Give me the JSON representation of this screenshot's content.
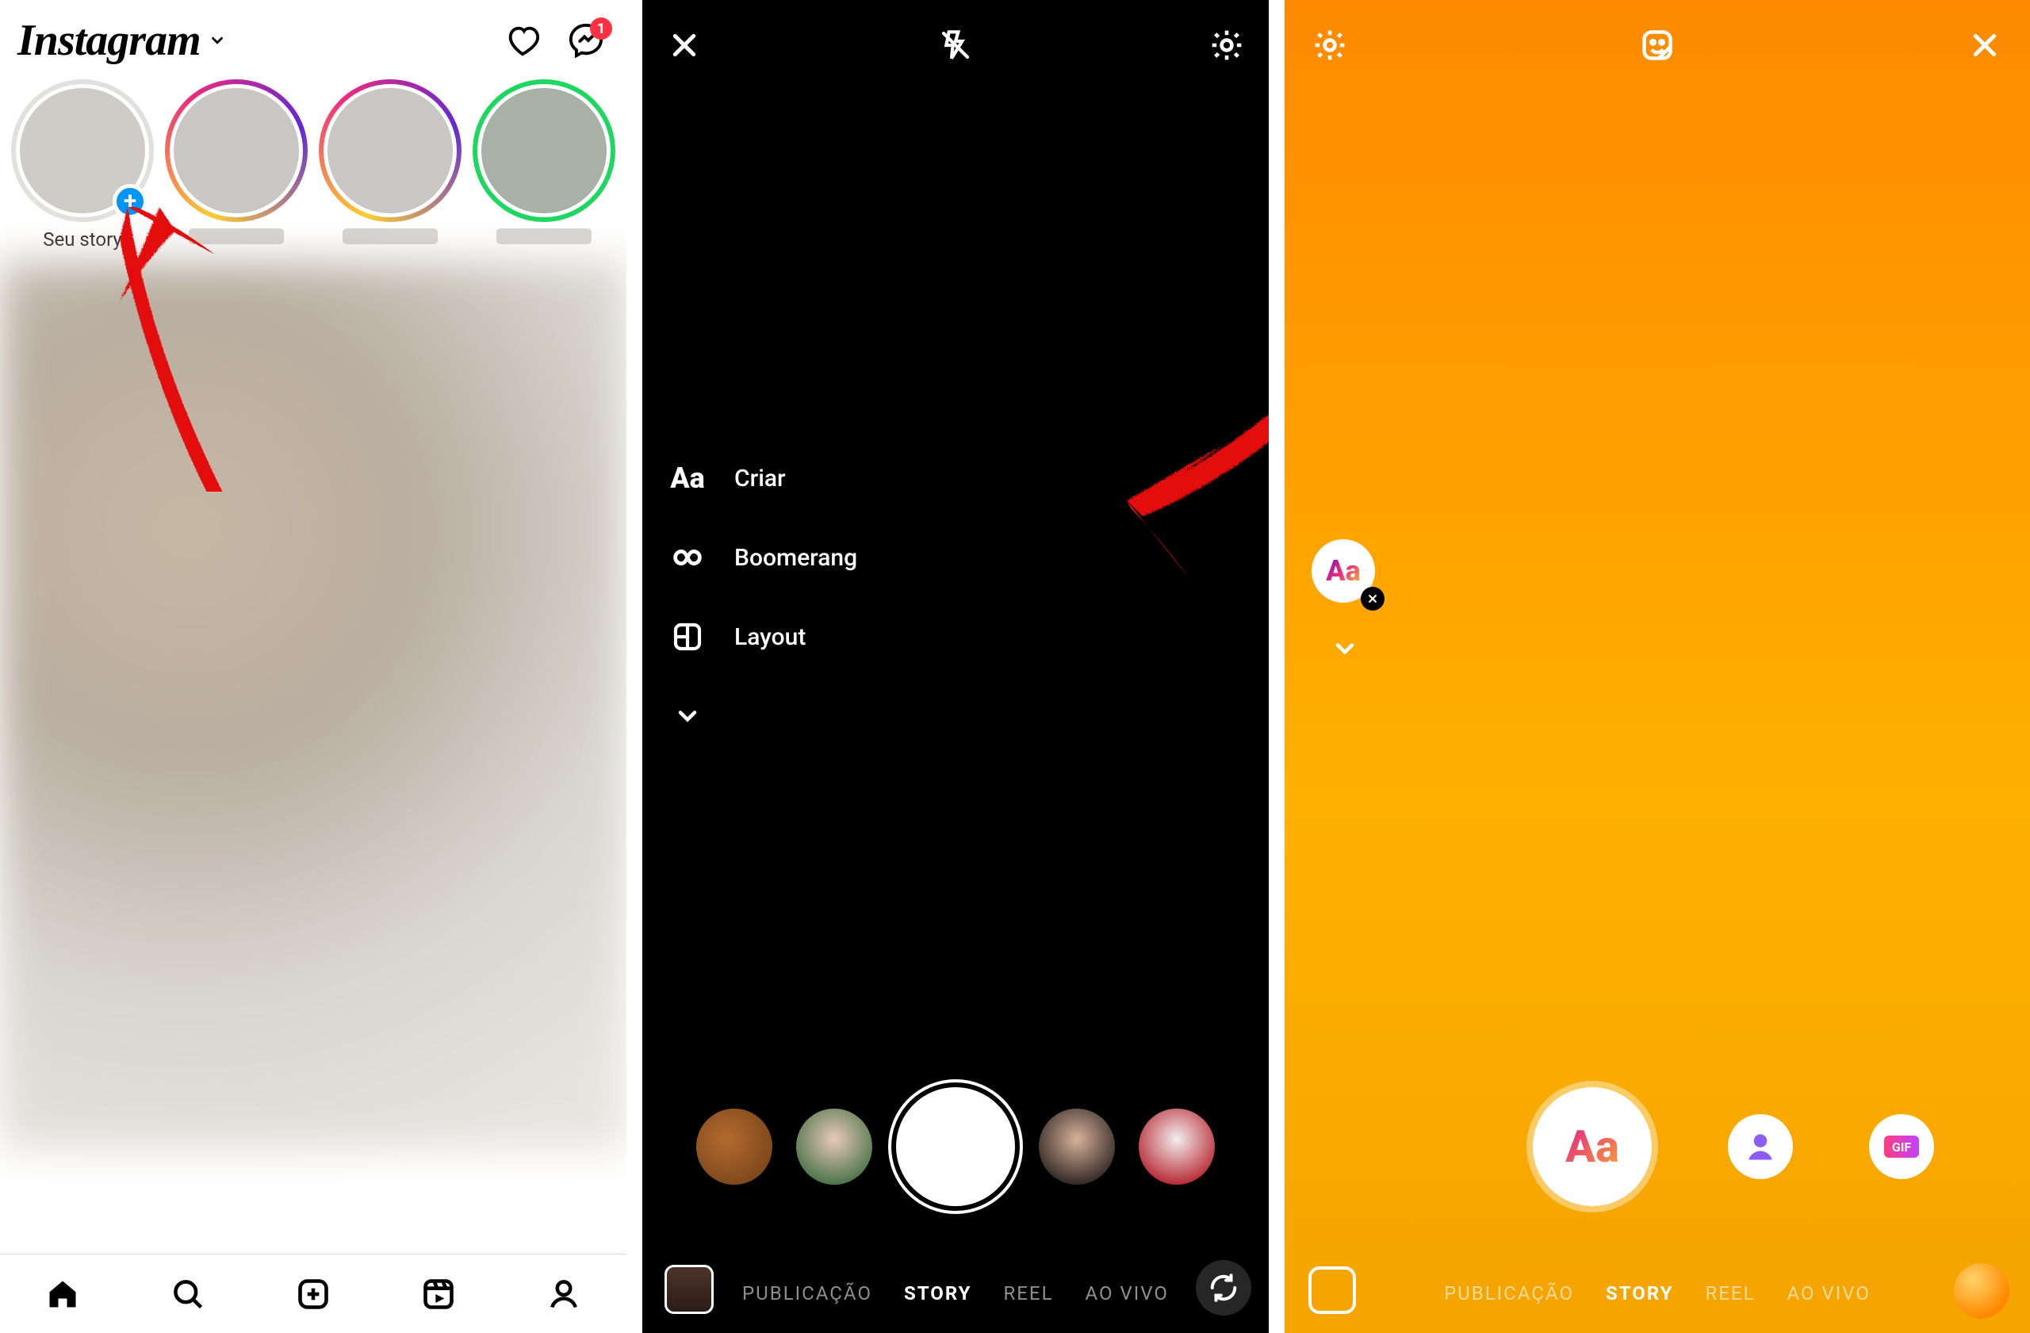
{
  "panel1": {
    "logo": "Instagram",
    "messenger_badge": "1",
    "stories": {
      "self_label": "Seu story"
    },
    "bottom_nav": [
      "home",
      "search",
      "add",
      "reels",
      "profile"
    ]
  },
  "panel2": {
    "tools": {
      "criar": "Criar",
      "boomerang": "Boomerang",
      "layout": "Layout"
    },
    "modes": {
      "publicacao": "PUBLICAÇÃO",
      "story": "STORY",
      "reel": "REEL",
      "ao_vivo": "AO VIVO"
    }
  },
  "panel3": {
    "aa_label": "Aa",
    "gif_label": "GIF",
    "modes": {
      "publicacao": "PUBLICAÇÃO",
      "story": "STORY",
      "reel": "REEL",
      "ao_vivo": "AO VIVO"
    }
  }
}
